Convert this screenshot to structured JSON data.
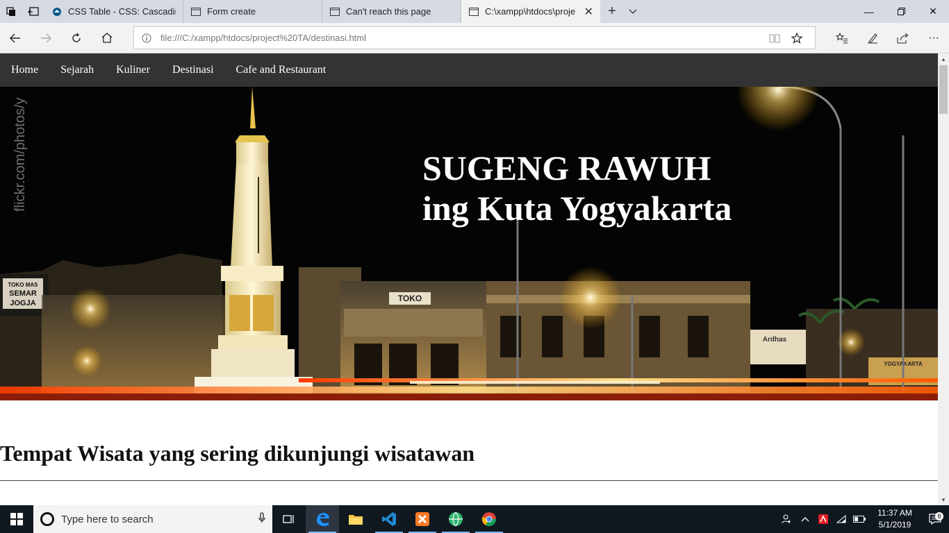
{
  "browser": {
    "tabs": [
      {
        "label": "CSS Table - CSS: Cascading",
        "icon": "mdn-icon",
        "active": false
      },
      {
        "label": "Form create",
        "icon": "page-icon",
        "active": false
      },
      {
        "label": "Can't reach this page",
        "icon": "page-icon",
        "active": false
      },
      {
        "label": "C:\\xampp\\htdocs\\proje",
        "icon": "page-icon",
        "active": true
      }
    ],
    "url": "file:///C:/xampp/htdocs/project%20TA/destinasi.html"
  },
  "site": {
    "nav": [
      "Home",
      "Sejarah",
      "Kuliner",
      "Destinasi",
      "Cafe and Restaurant"
    ],
    "hero": {
      "line1": "SUGENG RAWUH",
      "line2": "ing Kuta Yogyakarta",
      "watermark": "flickr.com/photos/y",
      "signs": {
        "shop_left_1": "TOKO MAS",
        "shop_left_2": "SEMAR",
        "shop_left_3": "JOGJA",
        "toko": "TOKO",
        "ardhas": "Ardhas",
        "right": "YOGYAKARTA"
      }
    },
    "section_title": "Tempat Wisata yang sering dikunjungi wisatawan"
  },
  "taskbar": {
    "search_placeholder": "Type here to search",
    "time": "11:37 AM",
    "date": "5/1/2019",
    "notification_count": "8"
  },
  "colors": {
    "nav_bg": "#333333",
    "taskbar_bg": "#101820",
    "tabstrip_bg": "#d5dae3"
  }
}
